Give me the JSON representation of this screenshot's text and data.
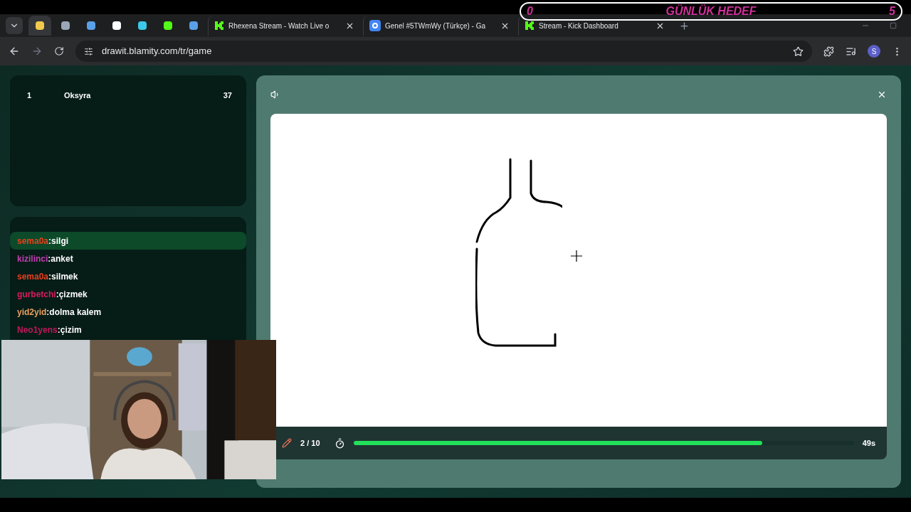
{
  "browser": {
    "icon_tabs": [
      {
        "selected": true,
        "color": "#f2c94c"
      },
      {
        "selected": false,
        "color": "#9aa7b8"
      },
      {
        "selected": false,
        "color": "#5aa0e8"
      },
      {
        "selected": false,
        "color": "#ffffff"
      },
      {
        "selected": false,
        "color": "#3cc8e8"
      },
      {
        "selected": false,
        "color": "#53fc18"
      },
      {
        "selected": false,
        "color": "#5aa0e8"
      }
    ],
    "tabs": [
      {
        "title": "Rhexena Stream - Watch Live o",
        "kind": "kick",
        "selected": false
      },
      {
        "title": "Genel #5TWmWy (Türkçe) - Ga",
        "kind": "google",
        "selected": false
      },
      {
        "title": "Stream - Kick Dashboard",
        "kind": "kick",
        "selected": false
      }
    ],
    "address": "drawit.blamity.com/tr/game",
    "profile_initial": "S"
  },
  "goal_overlay": {
    "current": "0",
    "title": "GÜNLÜK HEDEF",
    "target": "5"
  },
  "leaderboard": [
    {
      "rank": "1",
      "name": "Oksyra",
      "score": "37"
    }
  ],
  "chat": [
    {
      "user": "sema0a",
      "color": "#e8401c",
      "separator": ":",
      "message": "silgi",
      "selected": true
    },
    {
      "user": "kizilinci",
      "color": "#c23fb0",
      "separator": ":",
      "message": "anket",
      "selected": false
    },
    {
      "user": "sema0a",
      "color": "#e8401c",
      "separator": ":",
      "message": "silmek",
      "selected": false
    },
    {
      "user": "gurbetchi",
      "color": "#d81b60",
      "separator": ":",
      "message": "çizmek",
      "selected": false
    },
    {
      "user": "yid2yid",
      "color": "#e8a060",
      "separator": ":",
      "message": "dolma kalem",
      "selected": false
    },
    {
      "user": "Neo1yens",
      "color": "#c2185b",
      "separator": ":",
      "message": "çizim",
      "selected": false
    }
  ],
  "game": {
    "round": "2 / 10",
    "timer": "49s",
    "progress": {
      "level": 0.817
    }
  }
}
